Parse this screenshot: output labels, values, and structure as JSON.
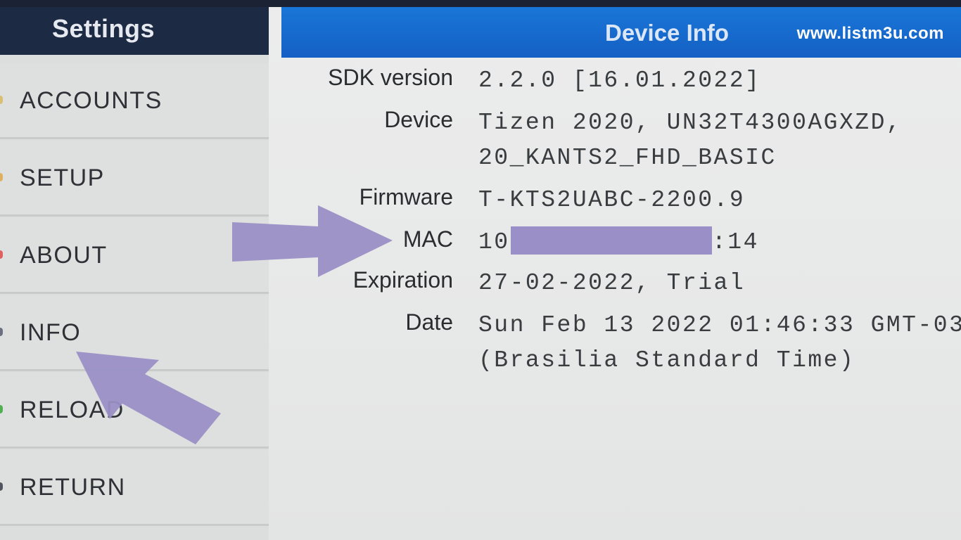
{
  "watermark": "www.listm3u.com",
  "sidebar": {
    "title": "Settings",
    "items": [
      {
        "label": "ACCOUNTS",
        "dot": "#d8c070"
      },
      {
        "label": "SETUP",
        "dot": "#e0b060"
      },
      {
        "label": "ABOUT",
        "dot": "#e06060"
      },
      {
        "label": "INFO",
        "dot": "#6a7080"
      },
      {
        "label": "RELOAD",
        "dot": "#50b050"
      },
      {
        "label": "RETURN",
        "dot": "#505560"
      }
    ]
  },
  "main": {
    "title": "Device Info",
    "rows": [
      {
        "label": "SDK version",
        "value": "2.2.0 [16.01.2022]"
      },
      {
        "label": "Device",
        "value": "Tizen 2020, UN32T4300AGXZD,",
        "value2": "20_KANTS2_FHD_BASIC"
      },
      {
        "label": "Firmware",
        "value": "T-KTS2UABC-2200.9"
      },
      {
        "label": "MAC",
        "value_prefix": "10",
        "value_suffix": ":14"
      },
      {
        "label": "Expiration",
        "value": "27-02-2022, Trial"
      },
      {
        "label": "Date",
        "value": "Sun Feb 13 2022 01:46:33 GMT-03",
        "value2": "(Brasilia Standard Time)"
      }
    ]
  },
  "colors": {
    "sidebar_header": "#1d2a44",
    "main_header": "#1976d8",
    "arrow": "#9a8fc6",
    "mask": "#9a8fc6"
  }
}
